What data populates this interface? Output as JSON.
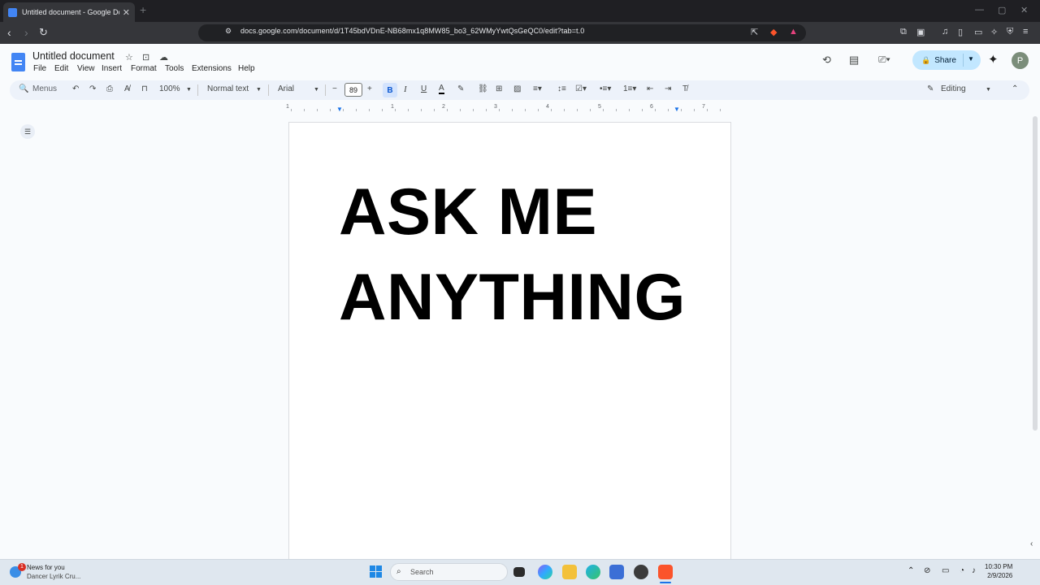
{
  "browser": {
    "tab_title": "Untitled document - Google Do",
    "tab_close": "✕",
    "new_tab": "+",
    "url": "docs.google.com/document/d/1T45bdVDnE-NB68mx1q8MW85_bo3_62WMyYwtQsGeQC0/edit?tab=t.0",
    "window_controls": [
      "—",
      "▢",
      "✕"
    ]
  },
  "docs": {
    "title": "Untitled document",
    "menus": [
      "File",
      "Edit",
      "View",
      "Insert",
      "Format",
      "Tools",
      "Extensions",
      "Help"
    ],
    "share_label": "Share",
    "avatar_letter": "P"
  },
  "toolbar": {
    "menus_search": "Menus",
    "zoom": "100%",
    "style": "Normal text",
    "font": "Arial",
    "font_size": "89",
    "bold": "B",
    "italic": "I",
    "underline": "U",
    "text_color": "A",
    "mode": "Editing"
  },
  "ruler": {
    "numbers": [
      "1",
      "1",
      "2",
      "3",
      "4",
      "5",
      "6",
      "7"
    ]
  },
  "document": {
    "lines": [
      "ASK ME",
      "ANYTHING"
    ]
  },
  "taskbar": {
    "news_title": "News for you",
    "news_sub": "Dancer Lyrik Cru...",
    "news_badge": "1",
    "search_placeholder": "Search",
    "time": "10:30 PM",
    "date": "2/9/2026"
  },
  "colors": {
    "share_bg": "#c2e7ff",
    "toolbar_bg": "#edf2fa",
    "docs_blue": "#4285f4",
    "bold_active": "#d3e3fd"
  }
}
